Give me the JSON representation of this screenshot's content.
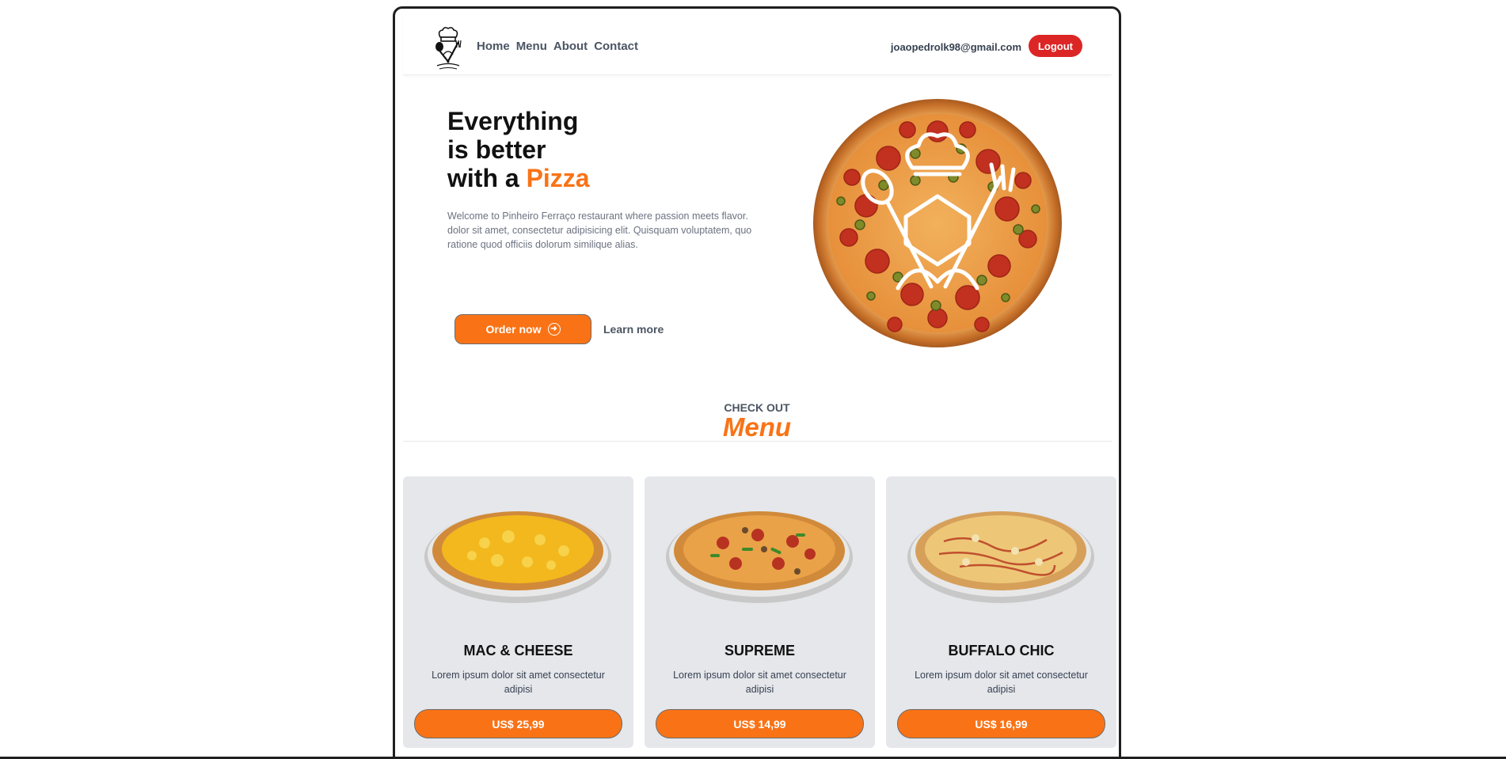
{
  "header": {
    "logo_icon": "chef-hat-utensils-logo-icon",
    "nav": [
      {
        "label": "Home"
      },
      {
        "label": "Menu"
      },
      {
        "label": "About"
      },
      {
        "label": "Contact"
      }
    ],
    "user_email": "joaopedrolk98@gmail.com",
    "logout_label": "Logout"
  },
  "hero": {
    "title_line1": "Everything",
    "title_line2": "is better",
    "title_line3_prefix": "with a ",
    "title_line3_accent": "Pizza",
    "description": "Welcome to Pinheiro Ferraço restaurant where passion meets flavor. dolor sit amet, consectetur adipisicing elit. Quisquam voluptatem, quo ratione quod officiis dolorum similique alias.",
    "order_label": "Order now",
    "order_icon": "arrow-right-circle-icon",
    "learn_more_label": "Learn more",
    "image_icon": "pepperoni-pizza-with-chef-logo"
  },
  "menu_section": {
    "kicker": "CHECK OUT",
    "title": "Menu"
  },
  "menu_items": [
    {
      "name": "MAC & CHEESE",
      "description": "Lorem ipsum dolor sit amet consectetur adipisi",
      "price": "US$ 25,99",
      "image_icon": "mac-cheese-pizza-image"
    },
    {
      "name": "SUPREME",
      "description": "Lorem ipsum dolor sit amet consectetur adipisi",
      "price": "US$ 14,99",
      "image_icon": "supreme-pizza-image"
    },
    {
      "name": "BUFFALO CHIC",
      "description": "Lorem ipsum dolor sit amet consectetur adipisi",
      "price": "US$ 16,99",
      "image_icon": "buffalo-chicken-pizza-image"
    }
  ],
  "colors": {
    "accent": "#f97316",
    "logout": "#dc2626",
    "card_bg": "#e5e7eb",
    "nav_text": "#4b5563"
  }
}
